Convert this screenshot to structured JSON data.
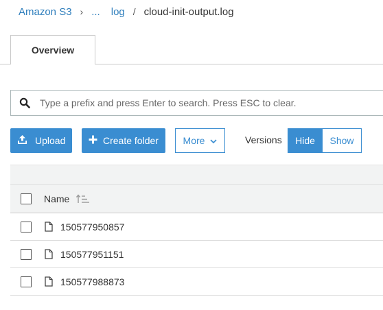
{
  "breadcrumb": {
    "root": "Amazon S3",
    "ellipsis": "...",
    "folder": "log",
    "separator_1": "›",
    "separator_2": "/",
    "current": "cloud-init-output.log"
  },
  "tabs": [
    {
      "label": "Overview",
      "active": true
    }
  ],
  "search": {
    "placeholder": "Type a prefix and press Enter to search. Press ESC to clear.",
    "value": ""
  },
  "toolbar": {
    "upload_label": "Upload",
    "create_folder_label": "Create folder",
    "more_label": "More",
    "versions_label": "Versions",
    "hide_label": "Hide",
    "show_label": "Show",
    "versions_selected": "Hide"
  },
  "table": {
    "column_name": "Name",
    "rows": [
      {
        "name": "150577950857"
      },
      {
        "name": "150577951151"
      },
      {
        "name": "150577988873"
      }
    ]
  },
  "colors": {
    "primary": "#3a8dd1",
    "link": "#2e7ebc",
    "header_bg": "#f2f3f3"
  },
  "icons": {
    "search": "search-icon",
    "upload": "upload-icon",
    "create_folder": "plus-icon",
    "more": "chevron-down-icon",
    "sort": "sort-icon",
    "file": "file-icon"
  }
}
